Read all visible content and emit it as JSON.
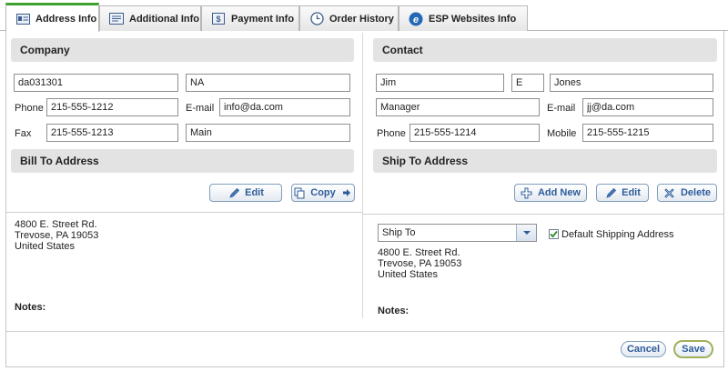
{
  "tabs": [
    {
      "label": "Address Info",
      "icon": "address-card-icon",
      "active": true
    },
    {
      "label": "Additional Info",
      "icon": "info-card-icon"
    },
    {
      "label": "Payment Info",
      "icon": "payment-icon"
    },
    {
      "label": "Order History",
      "icon": "history-icon"
    },
    {
      "label": "ESP Websites Info",
      "icon": "esp-logo-icon"
    }
  ],
  "company": {
    "title": "Company",
    "id_value": "da031301",
    "name_value": "NA",
    "phone_label": "Phone",
    "phone_value": "215-555-1212",
    "email_label": "E-mail",
    "email_value": "info@da.com",
    "fax_label": "Fax",
    "fax_value": "215-555-1213",
    "extra_value": "Main"
  },
  "contact": {
    "title": "Contact",
    "first_name": "Jim",
    "middle_initial": "E",
    "last_name": "Jones",
    "job_title": "Manager",
    "email_label": "E-mail",
    "email_value": "jj@da.com",
    "phone_label": "Phone",
    "phone_value": "215-555-1214",
    "mobile_label": "Mobile",
    "mobile_value": "215-555-1215"
  },
  "bill_to": {
    "title": "Bill To Address",
    "edit_label": "Edit",
    "copy_label": "Copy",
    "address_lines": [
      "4800 E. Street Rd.",
      "Trevose, PA 19053",
      "United States"
    ],
    "notes_label": "Notes:"
  },
  "ship_to": {
    "title": "Ship To Address",
    "add_new_label": "Add New",
    "edit_label": "Edit",
    "delete_label": "Delete",
    "select_value": "Ship To",
    "default_checked": true,
    "default_label": "Default Shipping Address",
    "address_lines": [
      "4800 E. Street Rd.",
      "Trevose, PA 19053",
      "United States"
    ],
    "notes_label": "Notes:"
  },
  "footer": {
    "cancel_label": "Cancel",
    "save_label": "Save"
  },
  "colors": {
    "active_tab_accent": "#3da32e",
    "button_text": "#2d5c9a",
    "section_header_bg": "#e3e3e3"
  }
}
